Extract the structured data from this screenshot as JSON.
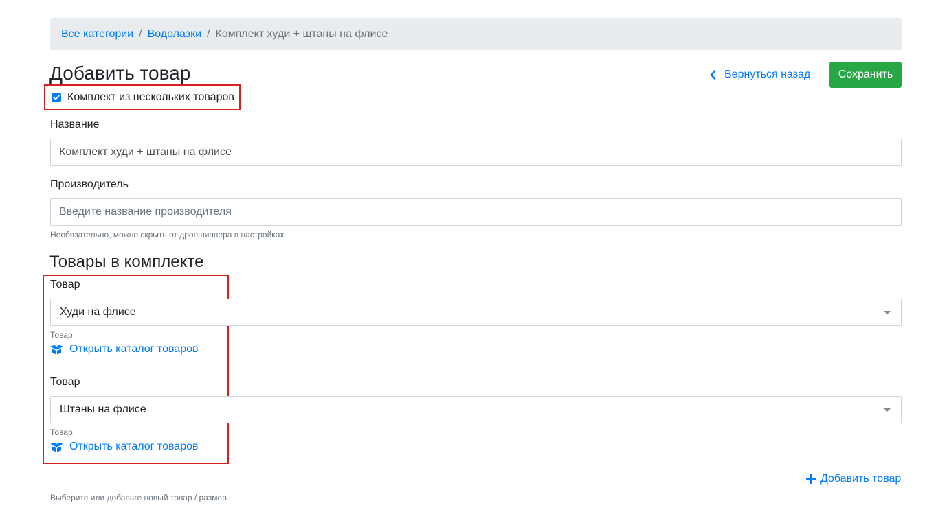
{
  "breadcrumb": {
    "items": [
      "Все категории",
      "Водолазки"
    ],
    "separator": "/",
    "current": "Комплект худи + штаны на флисе"
  },
  "header": {
    "title": "Добавить товар",
    "back_label": "Вернуться назад",
    "save_label": "Сохранить"
  },
  "kit_checkbox": {
    "label": "Комплект из нескольких товаров",
    "checked": true
  },
  "name_field": {
    "label": "Название",
    "value": "Комплект худи + штаны на флисе"
  },
  "manufacturer_field": {
    "label": "Производитель",
    "placeholder": "Введите название производителя",
    "help": "Необязательно, можно скрыть от дропшиппера в настройках"
  },
  "kit_section": {
    "title": "Товары в комплекте",
    "products": [
      {
        "label": "Товар",
        "value": "Худи на флисе",
        "help": "Товар",
        "catalog_link": "Открыть каталог товаров"
      },
      {
        "label": "Товар",
        "value": "Штаны на флисе",
        "help": "Товар",
        "catalog_link": "Открыть каталог товаров"
      }
    ],
    "add_label": "Добавить товар",
    "footer_help": "Выберите или добавьте новый товар / размер"
  },
  "colors": {
    "accent": "#007bff",
    "success": "#28a745",
    "highlight": "#dc1f1f"
  },
  "icons": {
    "back": "chevron-left-icon",
    "catalog": "box-open-icon",
    "add": "plus-icon",
    "check": "check-icon"
  }
}
